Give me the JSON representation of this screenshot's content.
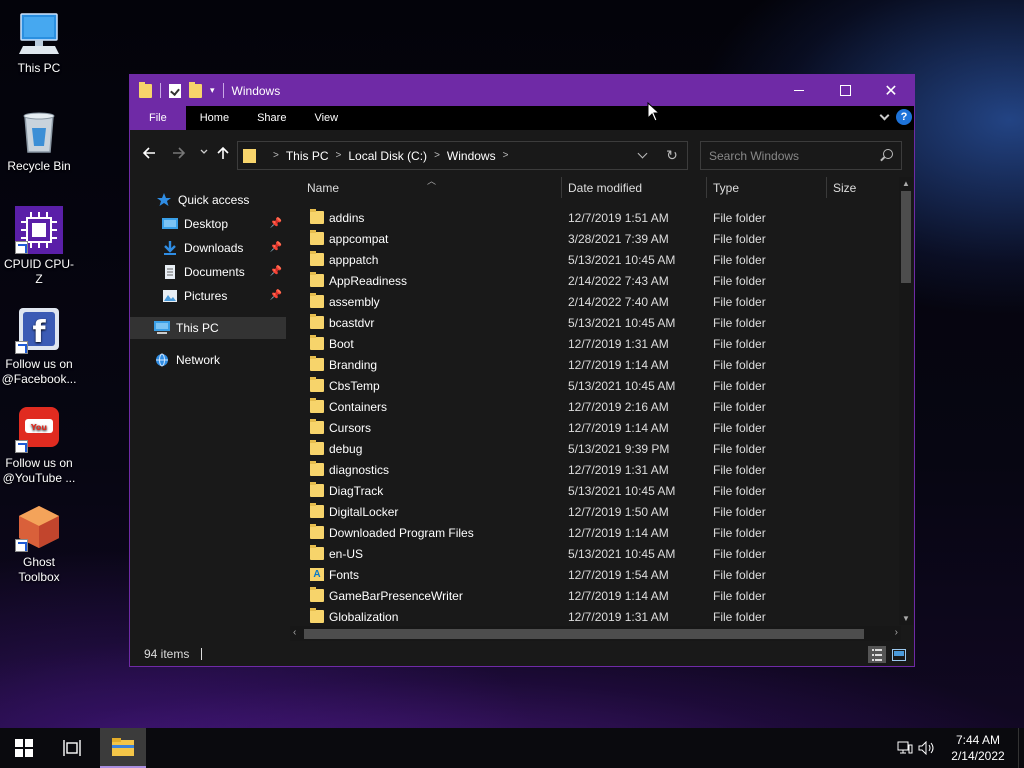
{
  "desktop": {
    "icons": [
      {
        "label": "This PC"
      },
      {
        "label": "Recycle Bin"
      },
      {
        "label": "CPUID CPU-Z"
      },
      {
        "label": "Follow us on @Facebook..."
      },
      {
        "label": "Follow us on @YouTube ..."
      },
      {
        "label": "Ghost Toolbox"
      }
    ]
  },
  "window": {
    "title": "Windows",
    "ribbon_tabs": [
      "File",
      "Home",
      "Share",
      "View"
    ],
    "help_label": "?",
    "breadcrumbs": [
      "This PC",
      "Local Disk (C:)",
      "Windows"
    ],
    "search_placeholder": "Search Windows",
    "accent_color": "#6f2aa6"
  },
  "nav_pane": {
    "quick_access": "Quick access",
    "items": [
      {
        "label": "Desktop",
        "pinned": true
      },
      {
        "label": "Downloads",
        "pinned": true
      },
      {
        "label": "Documents",
        "pinned": true
      },
      {
        "label": "Pictures",
        "pinned": true
      }
    ],
    "this_pc": "This PC",
    "network": "Network"
  },
  "columns": {
    "name": "Name",
    "date": "Date modified",
    "type": "Type",
    "size": "Size"
  },
  "files": [
    {
      "name": "addins",
      "date": "12/7/2019 1:51 AM",
      "type": "File folder"
    },
    {
      "name": "appcompat",
      "date": "3/28/2021 7:39 AM",
      "type": "File folder"
    },
    {
      "name": "apppatch",
      "date": "5/13/2021 10:45 AM",
      "type": "File folder"
    },
    {
      "name": "AppReadiness",
      "date": "2/14/2022 7:43 AM",
      "type": "File folder"
    },
    {
      "name": "assembly",
      "date": "2/14/2022 7:40 AM",
      "type": "File folder"
    },
    {
      "name": "bcastdvr",
      "date": "5/13/2021 10:45 AM",
      "type": "File folder"
    },
    {
      "name": "Boot",
      "date": "12/7/2019 1:31 AM",
      "type": "File folder"
    },
    {
      "name": "Branding",
      "date": "12/7/2019 1:14 AM",
      "type": "File folder"
    },
    {
      "name": "CbsTemp",
      "date": "5/13/2021 10:45 AM",
      "type": "File folder"
    },
    {
      "name": "Containers",
      "date": "12/7/2019 2:16 AM",
      "type": "File folder"
    },
    {
      "name": "Cursors",
      "date": "12/7/2019 1:14 AM",
      "type": "File folder"
    },
    {
      "name": "debug",
      "date": "5/13/2021 9:39 PM",
      "type": "File folder"
    },
    {
      "name": "diagnostics",
      "date": "12/7/2019 1:31 AM",
      "type": "File folder"
    },
    {
      "name": "DiagTrack",
      "date": "5/13/2021 10:45 AM",
      "type": "File folder"
    },
    {
      "name": "DigitalLocker",
      "date": "12/7/2019 1:50 AM",
      "type": "File folder"
    },
    {
      "name": "Downloaded Program Files",
      "date": "12/7/2019 1:14 AM",
      "type": "File folder"
    },
    {
      "name": "en-US",
      "date": "5/13/2021 10:45 AM",
      "type": "File folder"
    },
    {
      "name": "Fonts",
      "date": "12/7/2019 1:54 AM",
      "type": "File folder",
      "icon": "fonts-folder-icon"
    },
    {
      "name": "GameBarPresenceWriter",
      "date": "12/7/2019 1:14 AM",
      "type": "File folder"
    },
    {
      "name": "Globalization",
      "date": "12/7/2019 1:31 AM",
      "type": "File folder"
    }
  ],
  "status": {
    "item_count": "94 items"
  },
  "taskbar": {
    "time": "7:44 AM",
    "date": "2/14/2022"
  }
}
